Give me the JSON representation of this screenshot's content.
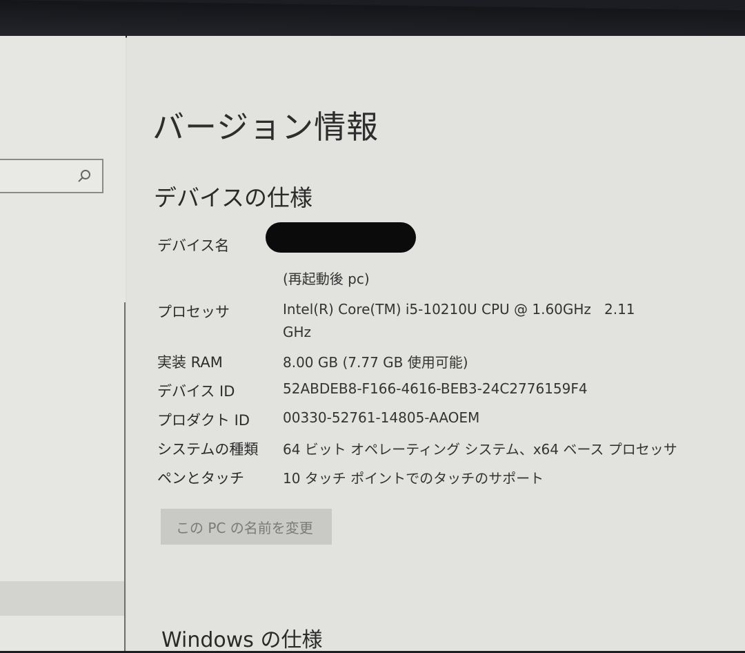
{
  "page_title": "バージョン情報",
  "device_spec": {
    "section_title": "デバイスの仕様",
    "rows": [
      {
        "label": "デバイス名",
        "value": "",
        "value2": "(再起動後 pc)"
      },
      {
        "label": "プロセッサ",
        "value": "Intel(R) Core(TM) i5-10210U CPU @ 1.60GHz   2.11",
        "value2": "GHz"
      },
      {
        "label": "実装 RAM",
        "value": "8.00 GB (7.77 GB 使用可能)"
      },
      {
        "label": "デバイス ID",
        "value": "52ABDEB8-F166-4616-BEB3-24C2776159F4"
      },
      {
        "label": "プロダクト ID",
        "value": "00330-52761-14805-AAOEM"
      },
      {
        "label": "システムの種類",
        "value": "64 ビット オペレーティング システム、x64 ベース プロセッサ"
      },
      {
        "label": "ペンとタッチ",
        "value": "10 タッチ ポイントでのタッチのサポート"
      }
    ],
    "rename_button": "この PC の名前を変更"
  },
  "windows_spec": {
    "section_title": "Windows の仕様"
  },
  "icons": {
    "search": "search-icon"
  }
}
